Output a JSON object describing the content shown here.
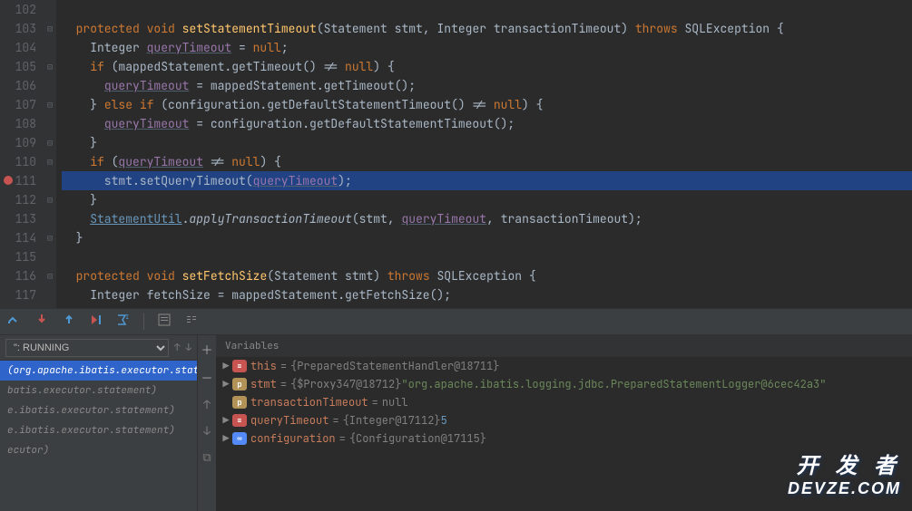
{
  "editor": {
    "lines": [
      {
        "n": 102,
        "fold": "",
        "html": ""
      },
      {
        "n": 103,
        "fold": "⊟",
        "html": "  <span class='kw'>protected</span> <span class='kw'>void</span> <span class='mname'>setStatementTimeout</span>(Statement stmt<span class='punc'>,</span> Integer transactionTimeout) <span class='kw'>throws</span> SQLException {"
      },
      {
        "n": 104,
        "fold": "",
        "html": "    Integer <span class='param'>queryTimeout</span> = <span class='kw'>null</span>;"
      },
      {
        "n": 105,
        "fold": "⊟",
        "html": "    <span class='kw'>if</span> (mappedStatement.getTimeout() != <span class='kw'>null</span>) {"
      },
      {
        "n": 106,
        "fold": "",
        "html": "      <span class='param'>queryTimeout</span> = mappedStatement.getTimeout();"
      },
      {
        "n": 107,
        "fold": "⊟",
        "html": "    } <span class='kw'>else if</span> (configuration.getDefaultStatementTimeout() != <span class='kw'>null</span>) {"
      },
      {
        "n": 108,
        "fold": "",
        "html": "      <span class='param'>queryTimeout</span> = configuration.getDefaultStatementTimeout();"
      },
      {
        "n": 109,
        "fold": "⊟",
        "html": "    }"
      },
      {
        "n": 110,
        "fold": "⊟",
        "html": "    <span class='kw'>if</span> (<span class='param'>queryTimeout</span> != <span class='kw'>null</span>) {"
      },
      {
        "n": 111,
        "fold": "",
        "bp": true,
        "hl": true,
        "html": "      stmt.setQueryTimeout(<span class='param'>queryTimeout</span>);"
      },
      {
        "n": 112,
        "fold": "⊟",
        "html": "    }"
      },
      {
        "n": 113,
        "fold": "",
        "html": "    <span class='link'>StatementUtil</span>.<span class='ital'>applyTransactionTimeout</span>(stmt<span class='punc'>,</span> <span class='param'>queryTimeout</span><span class='punc'>,</span> transactionTimeout);"
      },
      {
        "n": 114,
        "fold": "⊟",
        "html": "  }"
      },
      {
        "n": 115,
        "fold": "",
        "html": ""
      },
      {
        "n": 116,
        "fold": "⊟",
        "html": "  <span class='kw'>protected</span> <span class='kw'>void</span> <span class='mname'>setFetchSize</span>(Statement stmt) <span class='kw'>throws</span> SQLException {"
      },
      {
        "n": 117,
        "fold": "",
        "html": "    Integer fetchSize = mappedStatement.getFetchSize();"
      }
    ]
  },
  "frames": {
    "thread": "\": RUNNING",
    "rows": [
      {
        "text": "(org.apache.ibatis.executor.statement)",
        "sel": true
      },
      {
        "text": "batis.executor.statement)",
        "sel": false
      },
      {
        "text": "e.ibatis.executor.statement)",
        "sel": false
      },
      {
        "text": "e.ibatis.executor.statement)",
        "sel": false
      },
      {
        "text": "ecutor)",
        "sel": false
      }
    ]
  },
  "vars": {
    "header": "Variables",
    "items": [
      {
        "kind": "f",
        "expand": true,
        "name": "this",
        "eq": " = ",
        "val": "{PreparedStatementHandler@18711}"
      },
      {
        "kind": "p",
        "expand": true,
        "name": "stmt",
        "eq": " = ",
        "val": "{$Proxy347@18712} ",
        "str": "\"org.apache.ibatis.logging.jdbc.PreparedStatementLogger@6cec42a3\""
      },
      {
        "kind": "p",
        "expand": false,
        "name": "transactionTimeout",
        "eq": " = ",
        "val": "null"
      },
      {
        "kind": "f",
        "expand": true,
        "name": "queryTimeout",
        "eq": " = ",
        "val": "{Integer@17112} ",
        "num": "5"
      },
      {
        "kind": "l",
        "expand": true,
        "name": "configuration",
        "eq": " = ",
        "val": "{Configuration@17115}"
      }
    ]
  },
  "watermark": {
    "l1": "开 发 者",
    "l2": "DEVZE.COM",
    "sub": "@"
  }
}
